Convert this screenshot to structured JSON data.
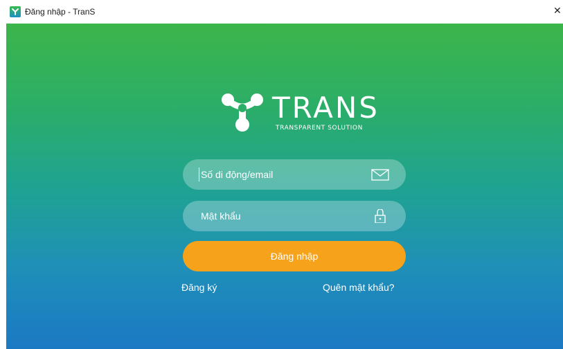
{
  "window": {
    "title": "Đăng nhập - TranS",
    "close_label": "✕"
  },
  "logo": {
    "wordmark": "TRANS",
    "tagline": "TRANSPARENT SOLUTION"
  },
  "form": {
    "email_placeholder": "Số di động/email",
    "password_placeholder": "Mật khẩu",
    "login_label": "Đăng nhập",
    "register_label": "Đăng ký",
    "forgot_label": "Quên mật khẩu?"
  },
  "colors": {
    "gradient_top": "#3cb54a",
    "gradient_bottom": "#1b79c4",
    "accent_button": "#f7a21b",
    "field_fill": "rgba(255,255,255,0.28)"
  },
  "icons": {
    "app": "trans-logo-icon",
    "email": "envelope-icon",
    "password": "lock-icon",
    "close": "close-icon"
  }
}
